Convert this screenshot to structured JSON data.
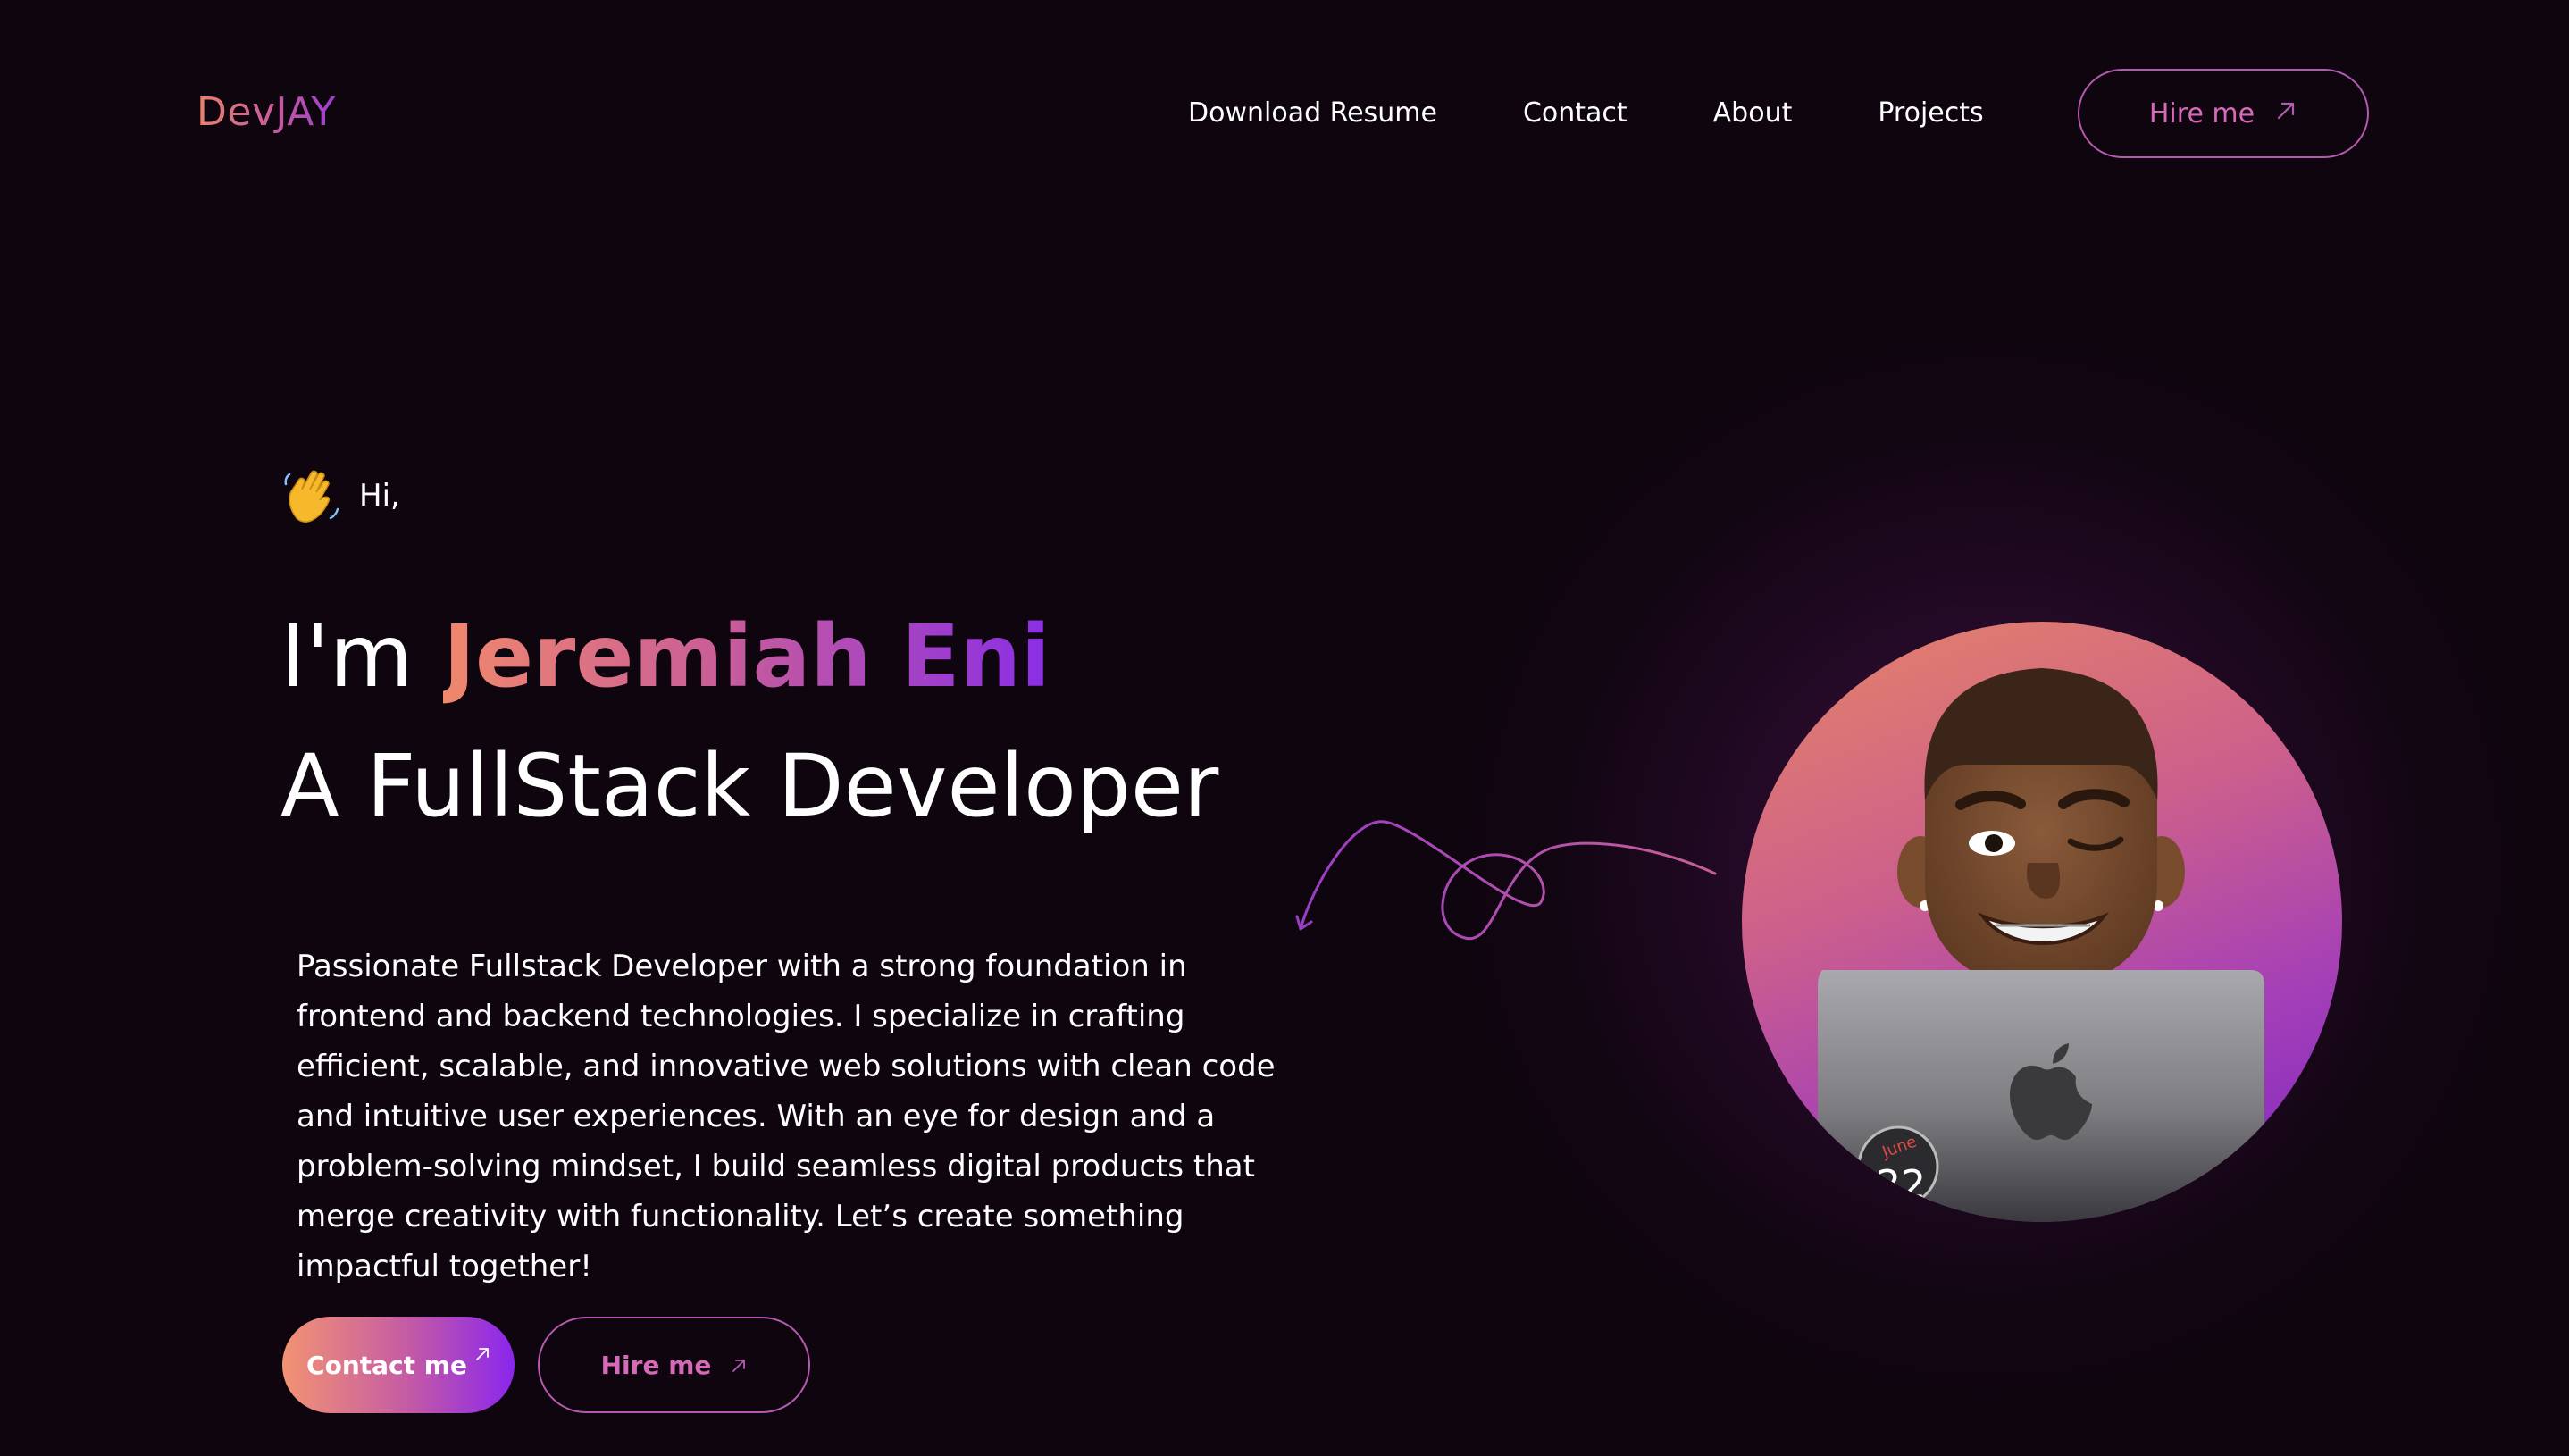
{
  "brand": {
    "logo": "DevJAY"
  },
  "nav": {
    "links": [
      {
        "label": "Download Resume"
      },
      {
        "label": "Contact"
      },
      {
        "label": "About"
      },
      {
        "label": "Projects"
      }
    ],
    "hire_button": {
      "label": "Hire me",
      "icon": "arrow-up-right-icon"
    }
  },
  "hero": {
    "greeting": {
      "icon": "waving-hand-icon",
      "text": "Hi,"
    },
    "intro_prefix": "I'm",
    "name": "Jeremiah Eni",
    "role": "A FullStack Developer",
    "bio": "Passionate Fullstack Developer with a strong foundation in frontend and backend technologies. I specialize in crafting efficient, scalable, and innovative web solutions with clean code and intuitive user experiences. With an eye for design and a problem-solving mindset, I build seamless digital products that merge creativity with functionality. Let’s create something impactful together!",
    "buttons": {
      "contact": {
        "label": "Contact me",
        "icon": "arrow-up-right-icon"
      },
      "hire": {
        "label": "Hire me",
        "icon": "arrow-up-right-icon"
      }
    },
    "avatar": {
      "icon": "memoji-avatar-with-laptop"
    }
  },
  "colors": {
    "background": "#0e050e",
    "accent_start": "#f0886c",
    "accent_mid": "#c95e98",
    "accent_end": "#8a2ee6",
    "button_border": "#b45ab0",
    "button_text": "#d66ab8"
  }
}
